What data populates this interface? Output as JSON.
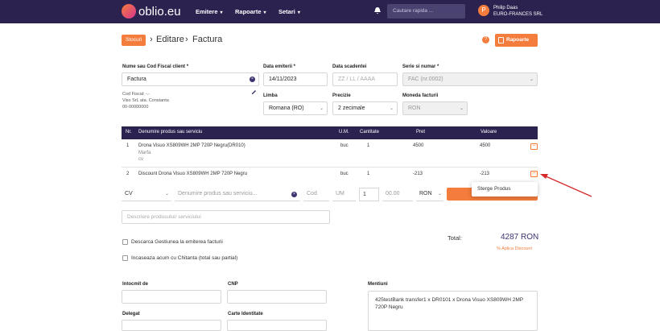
{
  "nav": {
    "brand": "oblio.eu",
    "menu": [
      {
        "label": "Emitere",
        "chevron": "▾"
      },
      {
        "label": "Rapoarte",
        "chevron": "▾"
      },
      {
        "label": "Setari",
        "chevron": "▾"
      }
    ],
    "search_placeholder": "Cautare rapida ...",
    "user_name": "Philip Daas",
    "user_company": "EURO-FRANCES SRL",
    "user_initial": "P"
  },
  "header": {
    "badge": "Stocuri",
    "crumbs": [
      "Editare",
      "Factura"
    ],
    "separator": "›",
    "help": "?",
    "rapoarte_button": "Rapoarte"
  },
  "form": {
    "client_label": "Nume sau Cod Fiscal client *",
    "client_value": "Factura",
    "client_info": [
      "Cod Fiscal: -.-",
      "Viso SrL ata. Constanta",
      "00-00000000"
    ],
    "data_emiterii_label": "Data emiterii *",
    "data_emiterii_value": "14/11/2023",
    "data_scadentei_label": "Data scadentei",
    "data_scadentei_placeholder": "ZZ / LL / AAAA",
    "serie_label": "Serie si numar *",
    "serie_value": "FAC (nr.0002)",
    "limba_label": "Limba",
    "limba_value": "Romana (RO)",
    "precizie_label": "Precizie",
    "precizie_value": "2 zecimale",
    "moneda_label": "Moneda facturii",
    "moneda_value": "RON",
    "select_chevron": "⌄"
  },
  "table": {
    "headers": [
      "Nr.",
      "Denumire produs sau serviciu",
      "U.M.",
      "Cantitate",
      "Pret",
      "Valoare"
    ],
    "rows": [
      {
        "nr": "1",
        "name": "Drona Visuo XS809WH 2MP 720P Negru(DR010)",
        "sub1": "Marfa",
        "sub2": "cv",
        "um": "buc",
        "qty": "1",
        "price": "4500",
        "value": "4500"
      },
      {
        "nr": "2",
        "name": "Discount Drona Visuo XS809WH 2MP 720P Negru",
        "um": "buc",
        "qty": "1",
        "price": "-213",
        "value": "-213"
      }
    ],
    "remove_glyph": "−"
  },
  "new_line": {
    "type_value": "CV",
    "name_placeholder": "Denumire produs sau serviciu...",
    "cod_placeholder": "Cod",
    "um_placeholder": "UM",
    "qty_value": "1",
    "price_value": "00.00",
    "currency_value": "RON",
    "chevron": "⌄"
  },
  "dropdown": {
    "item": "Sterge Produs"
  },
  "description_placeholder": "Descriere produsului/ serviciului",
  "checkboxes": [
    {
      "label": "Descarca Gestiunea la emiterea facturii"
    },
    {
      "label": "Incaseaza acum cu Chitanta (total sau partial)"
    }
  ],
  "totals": {
    "label": "Total:",
    "value": "4287 RON",
    "discount_link": "% Aplica Discount"
  },
  "bottom": {
    "intocmit_label": "Intocmit de",
    "cnp_label": "CNP",
    "delegat_label": "Delegat",
    "carte_label": "Carte Identitate",
    "mentiuni_label": "Mentiuni",
    "mentiuni_value": "425testBank transfer1 x DR0101 x Drona Visuo XS809WH 2MP 720P Negru"
  },
  "colors": {
    "nav_bg": "#2b2250",
    "accent": "#f47c3c",
    "arrow": "#d62b2b"
  }
}
